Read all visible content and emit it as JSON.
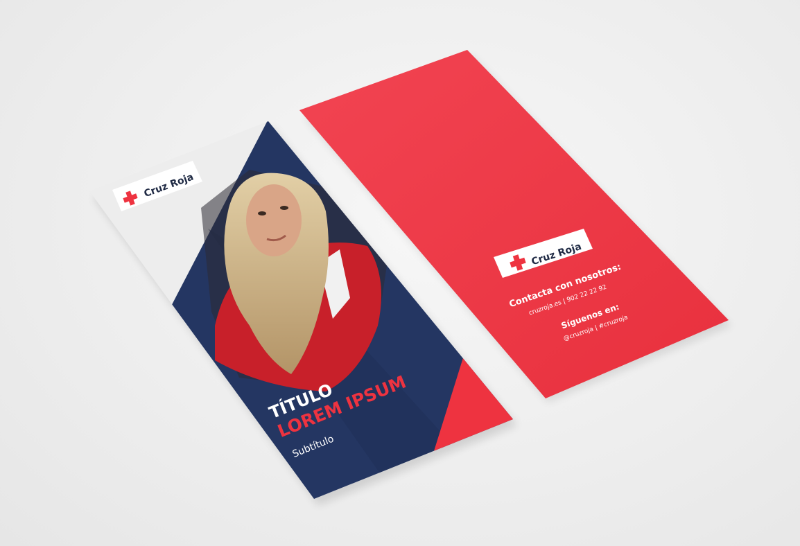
{
  "front": {
    "logo_text": "Cruz Roja",
    "title_line1": "TÍTULO",
    "title_line2": "LOREM IPSUM",
    "subtitle": "Subtítulo"
  },
  "back": {
    "logo_text": "Cruz Roja",
    "contact_heading": "Contacta con nosotros:",
    "contact_line": "cruzroja.es | 902 22 22 92",
    "follow_heading": "Síguenos en:",
    "follow_line": "@cruzroja | #cruzroja"
  },
  "colors": {
    "navy": "#243662",
    "red": "#ee3340",
    "paper": "#ededed"
  }
}
